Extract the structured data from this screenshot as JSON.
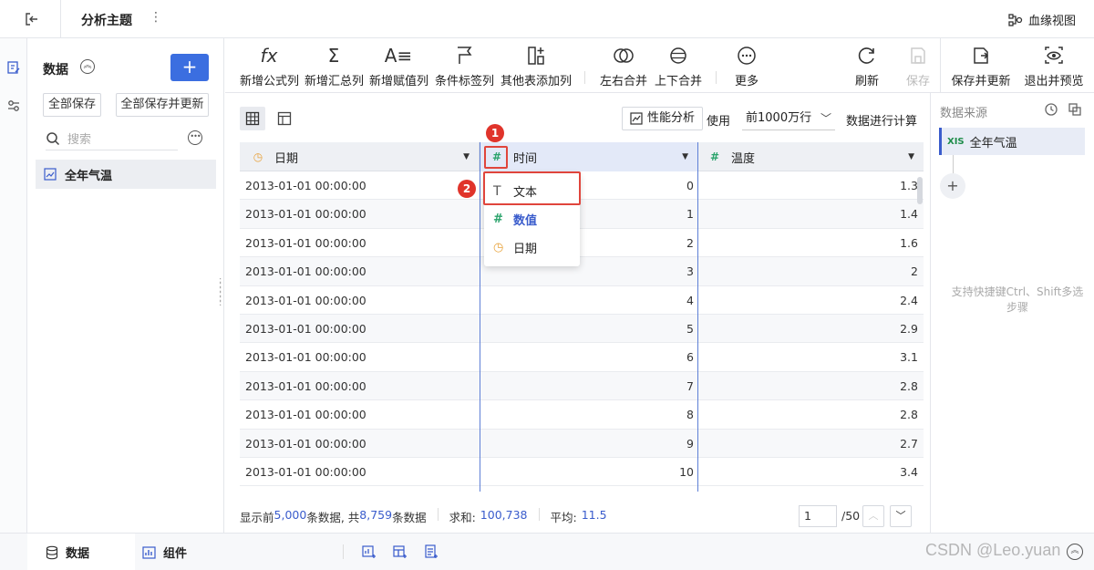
{
  "topbar": {
    "title": "分析主题",
    "more": "⋮",
    "lineage_label": "血缘视图"
  },
  "data_panel": {
    "title": "数据",
    "add_label": "+",
    "save_all": "全部保存",
    "save_all_update": "全部保存并更新",
    "search_placeholder": "搜索",
    "table_name": "全年气温"
  },
  "toolbar": {
    "formula": "新增公式列",
    "summary": "新增汇总列",
    "assign": "新增赋值列",
    "tag": "条件标签列",
    "other": "其他表添加列",
    "merge_lr": "左右合并",
    "merge_ud": "上下合并",
    "more": "更多",
    "refresh": "刷新",
    "save": "保存",
    "save_update": "保存并更新",
    "exit_preview": "退出并预览",
    "icons": {
      "formula": "fx",
      "summary": "Σ",
      "assign": "A≡",
      "more": "···"
    }
  },
  "view": {
    "perf_label": "性能分析",
    "use_label": "使用",
    "rows_value": "前1000万行",
    "calc_label": "数据进行计算"
  },
  "table": {
    "columns": [
      {
        "name": "日期",
        "type_icon": "◷"
      },
      {
        "name": "时间",
        "type_icon": "#"
      },
      {
        "name": "温度",
        "type_icon": "#"
      }
    ],
    "rows": [
      [
        "2013-01-01 00:00:00",
        "0",
        "1.3"
      ],
      [
        "2013-01-01 00:00:00",
        "1",
        "1.4"
      ],
      [
        "2013-01-01 00:00:00",
        "2",
        "1.6"
      ],
      [
        "2013-01-01 00:00:00",
        "3",
        "2"
      ],
      [
        "2013-01-01 00:00:00",
        "4",
        "2.4"
      ],
      [
        "2013-01-01 00:00:00",
        "5",
        "2.9"
      ],
      [
        "2013-01-01 00:00:00",
        "6",
        "3.1"
      ],
      [
        "2013-01-01 00:00:00",
        "7",
        "2.8"
      ],
      [
        "2013-01-01 00:00:00",
        "8",
        "2.8"
      ],
      [
        "2013-01-01 00:00:00",
        "9",
        "2.7"
      ],
      [
        "2013-01-01 00:00:00",
        "10",
        "3.4"
      ]
    ]
  },
  "type_menu": {
    "items": [
      {
        "label": "文本",
        "icon": "T"
      },
      {
        "label": "数值",
        "icon": "#"
      },
      {
        "label": "日期",
        "icon": "◷"
      }
    ],
    "current": "数值"
  },
  "annotations": {
    "badge1": "1",
    "badge2": "2"
  },
  "footer": {
    "shown_prefix": "显示前",
    "shown_count": "5,000",
    "shown_mid": "条数据, 共",
    "total_count": "8,759",
    "total_suffix": "条数据",
    "sum_label": "求和:",
    "sum_value": "100,738",
    "avg_label": "平均:",
    "avg_value": "11.5",
    "page_value": "1",
    "page_total": "/50"
  },
  "right_panel": {
    "title": "数据来源",
    "source_name": "全年气温",
    "source_badge": "XIS",
    "hint": "支持快捷键Ctrl、Shift多选步骤"
  },
  "bottom_tabs": {
    "data": "数据",
    "component": "组件"
  },
  "watermark": "CSDN @Leo.yuan",
  "colors": {
    "accent": "#3b6ee0",
    "annotation_red": "#e0342b",
    "selected_col": "#5d7fd6"
  }
}
